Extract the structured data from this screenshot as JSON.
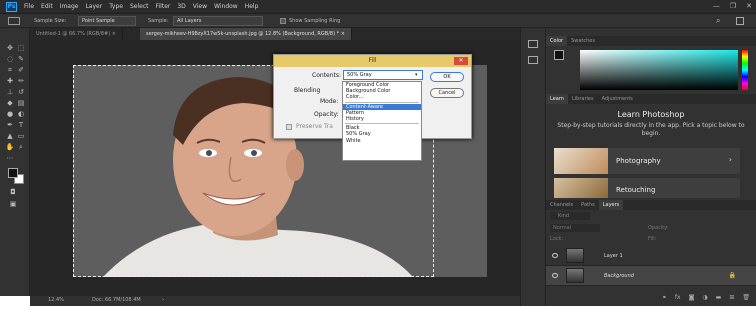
{
  "app": {
    "logo": "Ps"
  },
  "menu": [
    "File",
    "Edit",
    "Image",
    "Layer",
    "Type",
    "Select",
    "Filter",
    "3D",
    "View",
    "Window",
    "Help"
  ],
  "window_controls": {
    "minimize": "—",
    "restore": "❐",
    "close": "✕"
  },
  "options": {
    "sample_size_label": "Sample Size:",
    "sample_size_value": "Point Sample",
    "sample_label": "Sample:",
    "sample_value": "All Layers",
    "show_ring_label": "Show Sampling Ring"
  },
  "doc_tabs": [
    {
      "label": "Untitled-1 @ 66.7% (RGB/8#) ×"
    },
    {
      "label": "sergey-mikheev-H98zyX17w5k-unsplash.jpg @ 12.8% (Background, RGB/8) * ×"
    }
  ],
  "status": {
    "zoom": "12.4%",
    "doc": "Doc: 66.7M/108.4M"
  },
  "dialog": {
    "title": "Fill",
    "close": "✕",
    "contents_label": "Contents:",
    "contents_value": "50% Gray",
    "blending_label": "Blending",
    "mode_label": "Mode:",
    "opacity_label": "Opacity:",
    "preserve_label": "Preserve Tra",
    "ok": "OK",
    "cancel": "Cancel"
  },
  "dropdown": {
    "group1": [
      "Foreground Color",
      "Background Color",
      "Color..."
    ],
    "group2": [
      "Content-Aware",
      "Pattern",
      "History"
    ],
    "group3": [
      "Black",
      "50% Gray",
      "White"
    ],
    "highlighted": "Content-Aware"
  },
  "color_panel": {
    "tabs": [
      "Color",
      "Swatches"
    ]
  },
  "learn_panel": {
    "tabs": [
      "Learn",
      "Libraries",
      "Adjustments"
    ],
    "heading": "Learn Photoshop",
    "subtitle": "Step-by-step tutorials directly in the app. Pick a topic below to begin.",
    "cards": [
      {
        "label": "Photography"
      },
      {
        "label": "Retouching"
      }
    ]
  },
  "layers_panel": {
    "tabs": [
      "Channels",
      "Paths",
      "Layers"
    ],
    "kind": "Kind",
    "blend": "Normal",
    "opacity_label": "Opacity:",
    "lock_label": "Lock:",
    "fill_label": "Fill:",
    "layers": [
      {
        "name": "Layer 1"
      },
      {
        "name": "Background"
      }
    ]
  }
}
